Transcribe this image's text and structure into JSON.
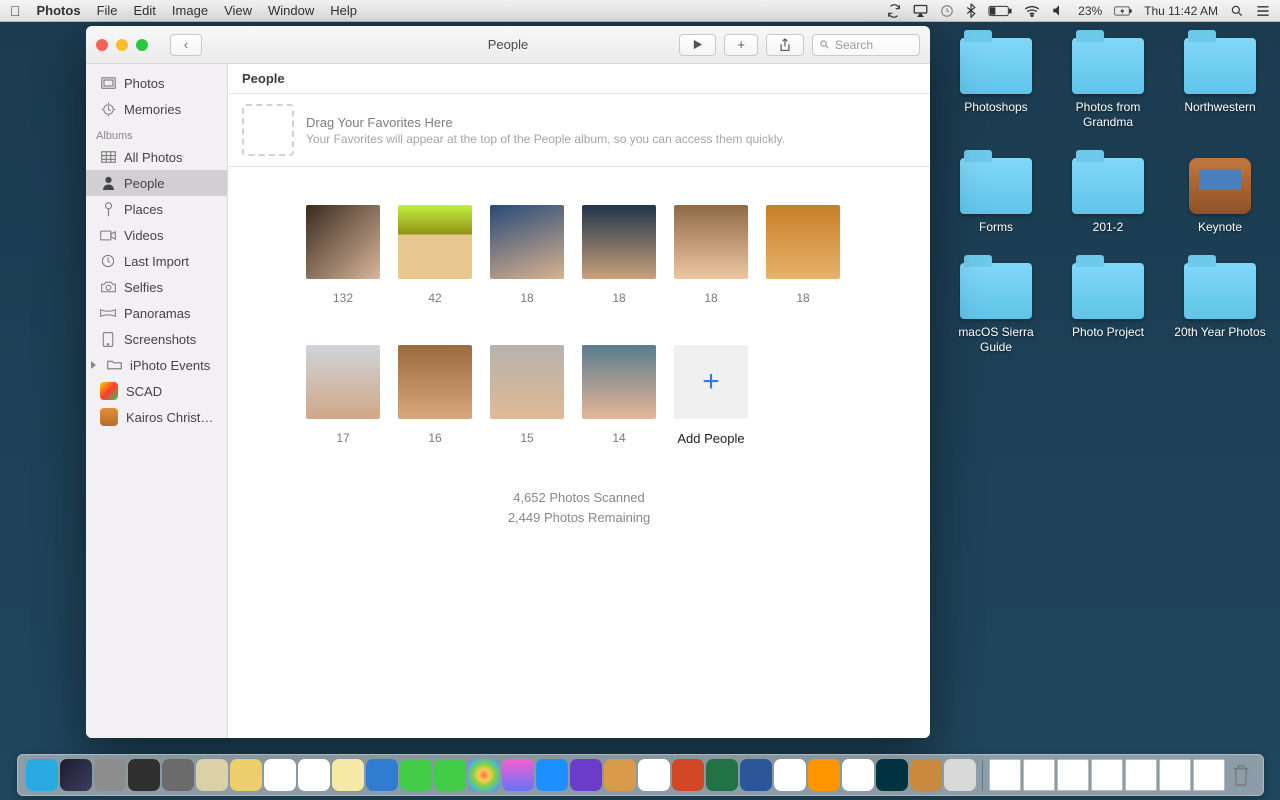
{
  "menubar": {
    "app": "Photos",
    "items": [
      "File",
      "Edit",
      "Image",
      "View",
      "Window",
      "Help"
    ],
    "battery_pct": "23%",
    "clock": "Thu 11:42 AM"
  },
  "desktop": [
    {
      "type": "folder",
      "label": "Photoshops"
    },
    {
      "type": "folder",
      "label": "Photos from Grandma"
    },
    {
      "type": "folder",
      "label": "Northwestern"
    },
    {
      "type": "folder",
      "label": "Forms"
    },
    {
      "type": "folder",
      "label": "201-2"
    },
    {
      "type": "keynote",
      "label": "Keynote"
    },
    {
      "type": "folder",
      "label": "macOS Sierra Guide"
    },
    {
      "type": "folder",
      "label": "Photo Project"
    },
    {
      "type": "folder",
      "label": "20th Year Photos"
    }
  ],
  "window": {
    "title": "People",
    "search_placeholder": "Search"
  },
  "sidebar": {
    "library": [
      {
        "icon": "photos",
        "label": "Photos"
      },
      {
        "icon": "memories",
        "label": "Memories"
      }
    ],
    "section": "Albums",
    "albums": [
      {
        "icon": "grid",
        "label": "All Photos",
        "sel": false
      },
      {
        "icon": "person",
        "label": "People",
        "sel": true
      },
      {
        "icon": "pin",
        "label": "Places",
        "sel": false
      },
      {
        "icon": "video",
        "label": "Videos",
        "sel": false
      },
      {
        "icon": "clock",
        "label": "Last Import",
        "sel": false
      },
      {
        "icon": "camera",
        "label": "Selfies",
        "sel": false
      },
      {
        "icon": "pano",
        "label": "Panoramas",
        "sel": false
      },
      {
        "icon": "screen",
        "label": "Screenshots",
        "sel": false
      }
    ],
    "user_albums": [
      {
        "kind": "folder",
        "label": "iPhoto Events"
      },
      {
        "kind": "color1",
        "label": "SCAD"
      },
      {
        "kind": "color2",
        "label": "Kairos Christ…"
      }
    ]
  },
  "main": {
    "header": "People",
    "drop_head": "Drag Your Favorites Here",
    "drop_sub": "Your Favorites will appear at the top of the People album, so you can access them quickly.",
    "people": [
      {
        "count": "132",
        "face": "f1"
      },
      {
        "count": "42",
        "face": "f2"
      },
      {
        "count": "18",
        "face": "f3"
      },
      {
        "count": "18",
        "face": "f4"
      },
      {
        "count": "18",
        "face": "f5"
      },
      {
        "count": "18",
        "face": "f6"
      },
      {
        "count": "17",
        "face": "f7"
      },
      {
        "count": "16",
        "face": "f8"
      },
      {
        "count": "15",
        "face": "f9"
      },
      {
        "count": "14",
        "face": "f10"
      }
    ],
    "add_label": "Add People",
    "scan1": "4,652 Photos Scanned",
    "scan2": "2,449 Photos Remaining"
  },
  "dock": {
    "apps": [
      {
        "name": "finder",
        "bg": "#29abe2"
      },
      {
        "name": "siri",
        "bg": "linear-gradient(135deg,#1b1b2e,#3e3e60)"
      },
      {
        "name": "launchpad",
        "bg": "#8d8d8d"
      },
      {
        "name": "mission-control",
        "bg": "#2f2f2f"
      },
      {
        "name": "sys-prefs",
        "bg": "#6b6b6b"
      },
      {
        "name": "notes1",
        "bg": "#dcd0a9"
      },
      {
        "name": "notes2",
        "bg": "#eccf6a"
      },
      {
        "name": "cal",
        "bg": "#fff"
      },
      {
        "name": "reminders",
        "bg": "#fff"
      },
      {
        "name": "textedit",
        "bg": "#f6e9a5"
      },
      {
        "name": "preview",
        "bg": "#2f7dd1"
      },
      {
        "name": "messages",
        "bg": "#43cc47"
      },
      {
        "name": "facetime",
        "bg": "#43cc47"
      },
      {
        "name": "photos",
        "bg": "radial-gradient(circle,#ff6a5a,#ffcb4a,#7ad24a,#4ab6d2,#a34ad2)"
      },
      {
        "name": "itunes",
        "bg": "linear-gradient(#f85ecf,#6573f7)"
      },
      {
        "name": "appstore",
        "bg": "#1e8fff"
      },
      {
        "name": "imovie",
        "bg": "#6b3cc9"
      },
      {
        "name": "garageband",
        "bg": "#d99a4a"
      },
      {
        "name": "pages",
        "bg": "#fff"
      },
      {
        "name": "ppt",
        "bg": "#d24726"
      },
      {
        "name": "excel",
        "bg": "#217346"
      },
      {
        "name": "word",
        "bg": "#2b579a"
      },
      {
        "name": "chrome",
        "bg": "#fff"
      },
      {
        "name": "firefox",
        "bg": "#ff9500"
      },
      {
        "name": "drive",
        "bg": "#fff"
      },
      {
        "name": "audition",
        "bg": "#00323f"
      },
      {
        "name": "box",
        "bg": "#c98a3e"
      },
      {
        "name": "scanner",
        "bg": "#d9d9d9"
      }
    ]
  }
}
